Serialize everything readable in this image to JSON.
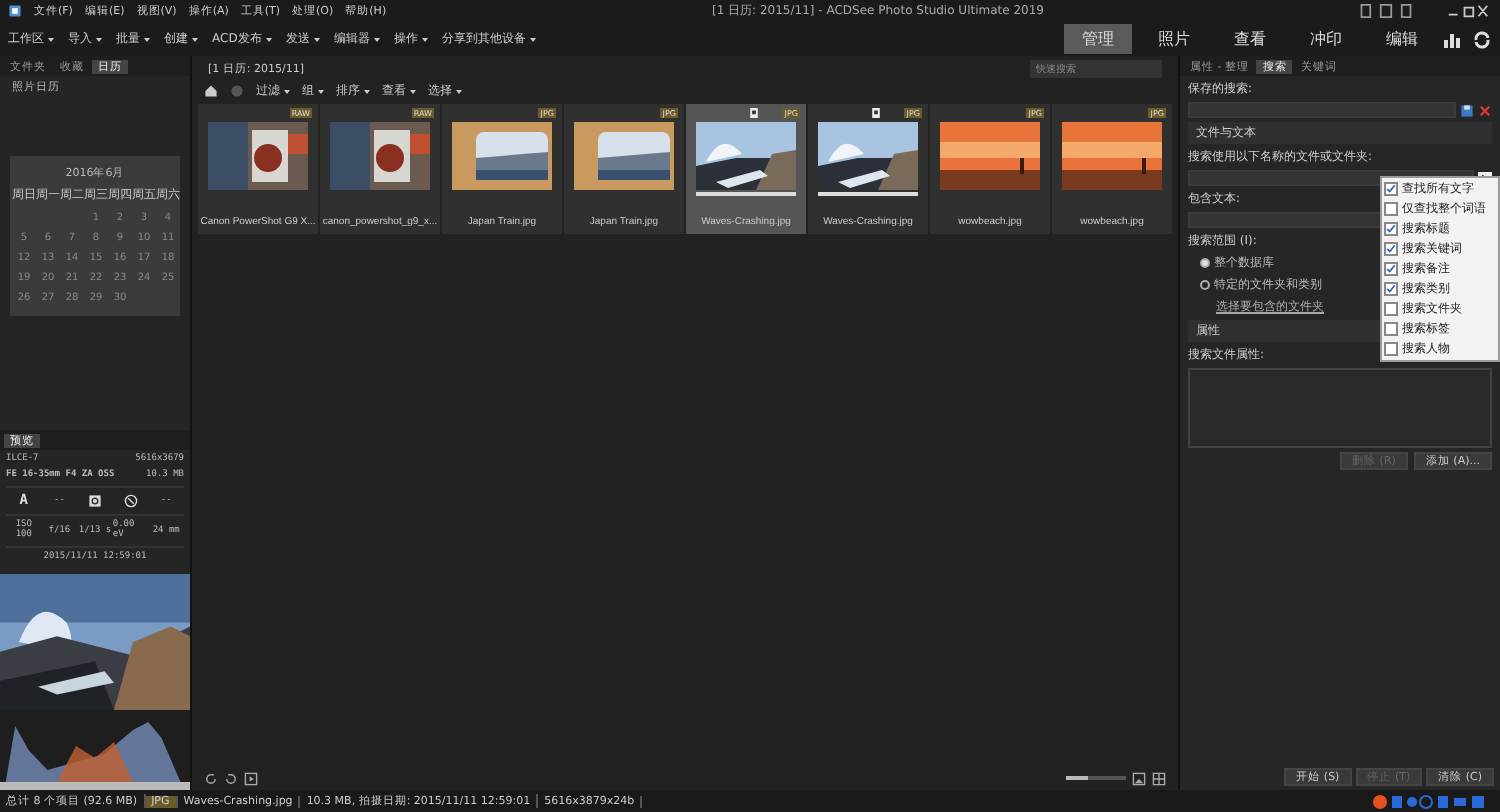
{
  "window": {
    "title": "[1 日历: 2015/11] - ACDSee Photo Studio Ultimate 2019"
  },
  "menu": [
    "文件(F)",
    "编辑(E)",
    "视图(V)",
    "操作(A)",
    "工具(T)",
    "处理(O)",
    "帮助(H)"
  ],
  "toolbar": [
    "工作区",
    "导入",
    "批量",
    "创建",
    "ACD发布",
    "发送",
    "编辑器",
    "操作",
    "分享到其他设备"
  ],
  "modes": [
    {
      "label": "管理",
      "selected": true
    },
    {
      "label": "照片",
      "selected": false
    },
    {
      "label": "查看",
      "selected": false
    },
    {
      "label": "冲印",
      "selected": false
    },
    {
      "label": "编辑",
      "selected": false
    }
  ],
  "left_tabs": [
    {
      "label": "文件夹",
      "selected": false
    },
    {
      "label": "收藏",
      "selected": false
    },
    {
      "label": "日历",
      "selected": true
    }
  ],
  "calendar": {
    "header": "照片日历",
    "month": "2016年6月",
    "weekdays": [
      "周日",
      "周一",
      "周二",
      "周三",
      "周四",
      "周五",
      "周六"
    ],
    "days": [
      "1",
      "2",
      "3",
      "4",
      "5",
      "6",
      "7",
      "8",
      "9",
      "10",
      "11",
      "12",
      "13",
      "14",
      "15",
      "16",
      "17",
      "18",
      "19",
      "20",
      "21",
      "22",
      "23",
      "24",
      "25",
      "26",
      "27",
      "28",
      "29",
      "30"
    ]
  },
  "preview": {
    "tab": "预览",
    "camera": "ILCE-7",
    "dimensions": "5616x3679",
    "lens": "FE 16-35mm F4 ZA OSS",
    "size": "10.3 MB",
    "mode": "A",
    "meter": "--",
    "flash_value": "--",
    "iso": "ISO 100",
    "aperture": "f/16",
    "shutter": "1/13 s",
    "exposure": "0.00 eV",
    "focal": "24 mm",
    "date": "2015/11/11 12:59:01"
  },
  "browser": {
    "path": "[1 日历: 2015/11]",
    "search_placeholder": "快速搜索",
    "tools": [
      "过滤",
      "组",
      "排序",
      "查看",
      "选择"
    ],
    "thumbnails": [
      {
        "name": "Canon PowerShot G9 X...",
        "badge": "RAW",
        "tagged": false,
        "selected": false
      },
      {
        "name": "canon_powershot_g9_x...",
        "badge": "RAW",
        "tagged": false,
        "selected": false
      },
      {
        "name": "Japan Train.jpg",
        "badge": "JPG",
        "tagged": false,
        "selected": false
      },
      {
        "name": "Japan Train.jpg",
        "badge": "JPG",
        "tagged": false,
        "selected": false
      },
      {
        "name": "Waves-Crashing.jpg",
        "badge": "JPG",
        "tagged": true,
        "selected": true
      },
      {
        "name": "Waves-Crashing.jpg",
        "badge": "JPG",
        "tagged": true,
        "selected": false
      },
      {
        "name": "wowbeach.jpg",
        "badge": "JPG",
        "tagged": false,
        "selected": false
      },
      {
        "name": "wowbeach.jpg",
        "badge": "JPG",
        "tagged": false,
        "selected": false
      }
    ],
    "zoom": {
      "level": 0.35
    }
  },
  "search_panel": {
    "tabs": [
      {
        "label": "属性 - 整理",
        "selected": false
      },
      {
        "label": "搜索",
        "selected": true
      },
      {
        "label": "关键词",
        "selected": false
      }
    ],
    "saved_label": "保存的搜索:",
    "section_text": "文件与文本",
    "name_label": "搜索使用以下名称的文件或文件夹:",
    "text_label": "包含文本:",
    "scope_label": "搜索范围 (I):",
    "scopes": [
      {
        "label": "整个数据库",
        "selected": true
      },
      {
        "label": "特定的文件夹和类别",
        "selected": false
      }
    ],
    "scope_link": "选择要包含的文件夹",
    "section_props": "属性",
    "props_label": "搜索文件属性:",
    "remove_button": "删除 (R)",
    "add_button": "添加 (A)...",
    "options": [
      {
        "label": "查找所有文字",
        "checked": true
      },
      {
        "label": "仅查找整个词语",
        "checked": false
      },
      {
        "label": "搜索标题",
        "checked": true
      },
      {
        "label": "搜索关键词",
        "checked": true
      },
      {
        "label": "搜索备注",
        "checked": true
      },
      {
        "label": "搜索类别",
        "checked": true
      },
      {
        "label": "搜索文件夹",
        "checked": false
      },
      {
        "label": "搜索标签",
        "checked": false
      },
      {
        "label": "搜索人物",
        "checked": false
      }
    ],
    "actions": [
      {
        "label": "开始 (S)",
        "disabled": false
      },
      {
        "label": "停止 (T)",
        "disabled": true
      },
      {
        "label": "清除 (C)",
        "disabled": false
      }
    ]
  },
  "status_bar": {
    "total": "总计 8 个项目 (92.6 MB)",
    "type": "JPG",
    "file": "Waves-Crashing.jpg",
    "info": "10.3 MB, 拍摄日期: 2015/11/11 12:59:01",
    "resolution": "5616x3879x24b"
  }
}
